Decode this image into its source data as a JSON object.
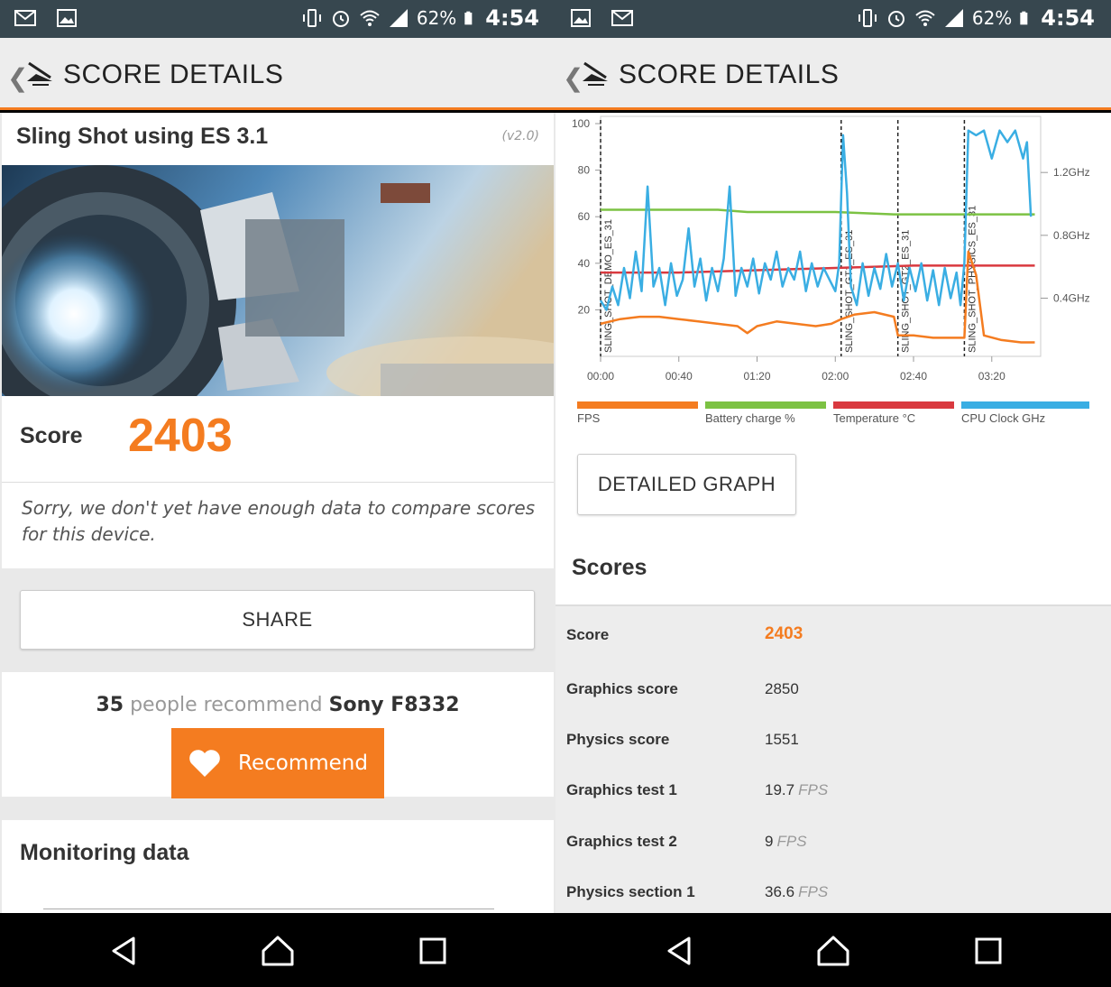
{
  "status": {
    "battery": "62%",
    "time": "4:54"
  },
  "appbar": {
    "title": "SCORE DETAILS"
  },
  "left": {
    "test_title": "Sling Shot using ES 3.1",
    "version": "(v2.0)",
    "score_label": "Score",
    "score_value": "2403",
    "compare_text": "Sorry, we don't yet have enough data to compare scores for this device.",
    "share_label": "SHARE",
    "recommend_count": "35",
    "recommend_text": "people recommend",
    "device": "Sony F8332",
    "recommend_button": "Recommend",
    "monitoring_title": "Monitoring data"
  },
  "right": {
    "detailed_graph_label": "DETAILED GRAPH",
    "scores_title": "Scores",
    "rows": [
      {
        "label": "Score",
        "value": "2403",
        "unit": ""
      },
      {
        "label": "Graphics score",
        "value": "2850",
        "unit": ""
      },
      {
        "label": "Physics score",
        "value": "1551",
        "unit": ""
      },
      {
        "label": "Graphics test 1",
        "value": "19.7",
        "unit": "FPS"
      },
      {
        "label": "Graphics test 2",
        "value": "9",
        "unit": "FPS"
      },
      {
        "label": "Physics section 1",
        "value": "36.6",
        "unit": "FPS"
      }
    ]
  },
  "colors": {
    "accent": "#f47c20",
    "fps": "#f47c20",
    "battery": "#7cc243",
    "temperature": "#d9393f",
    "cpu": "#3aaee3"
  },
  "chart_data": {
    "type": "line",
    "x_ticks": [
      "00:00",
      "00:40",
      "01:20",
      "02:00",
      "02:40",
      "03:20"
    ],
    "y_ticks_left": [
      "20",
      "40",
      "60",
      "80",
      "100"
    ],
    "y_ticks_right": [
      "0.4GHz",
      "0.8GHz",
      "1.2GHz"
    ],
    "ylim": [
      0,
      100
    ],
    "xlim_sec": [
      0,
      225
    ],
    "markers": [
      {
        "t": 0,
        "label": "SLING_SHOT_DEMO_ES_31"
      },
      {
        "t": 123,
        "label": "SLING_SHOT_GT1_ES_31"
      },
      {
        "t": 152,
        "label": "SLING_SHOT_GT2_ES_31"
      },
      {
        "t": 186,
        "label": "SLING_SHOT_PHYSICS_ES_31"
      }
    ],
    "series": [
      {
        "name": "FPS",
        "points": [
          [
            0,
            14
          ],
          [
            10,
            16
          ],
          [
            20,
            17
          ],
          [
            30,
            17
          ],
          [
            40,
            16
          ],
          [
            50,
            15
          ],
          [
            60,
            14
          ],
          [
            70,
            13
          ],
          [
            75,
            10
          ],
          [
            80,
            13
          ],
          [
            90,
            15
          ],
          [
            100,
            14
          ],
          [
            110,
            13
          ],
          [
            118,
            14
          ],
          [
            123,
            16
          ],
          [
            130,
            18
          ],
          [
            140,
            19
          ],
          [
            150,
            17
          ],
          [
            152,
            9
          ],
          [
            160,
            9
          ],
          [
            170,
            8
          ],
          [
            180,
            8
          ],
          [
            186,
            8
          ],
          [
            188,
            45
          ],
          [
            192,
            35
          ],
          [
            196,
            9
          ],
          [
            205,
            7
          ],
          [
            215,
            6
          ],
          [
            222,
            6
          ]
        ]
      },
      {
        "name": "Battery charge %",
        "points": [
          [
            0,
            63
          ],
          [
            60,
            63
          ],
          [
            75,
            62
          ],
          [
            120,
            62
          ],
          [
            150,
            61
          ],
          [
            180,
            61
          ],
          [
            222,
            61
          ]
        ]
      },
      {
        "name": "Temperature °C",
        "points": [
          [
            0,
            36
          ],
          [
            40,
            36
          ],
          [
            80,
            37
          ],
          [
            120,
            38
          ],
          [
            160,
            39
          ],
          [
            200,
            39
          ],
          [
            222,
            39
          ]
        ]
      },
      {
        "name": "CPU Clock GHz",
        "points": [
          [
            0,
            24
          ],
          [
            3,
            20
          ],
          [
            6,
            30
          ],
          [
            9,
            22
          ],
          [
            12,
            38
          ],
          [
            15,
            25
          ],
          [
            18,
            45
          ],
          [
            21,
            28
          ],
          [
            24,
            73
          ],
          [
            27,
            30
          ],
          [
            30,
            38
          ],
          [
            33,
            22
          ],
          [
            36,
            40
          ],
          [
            39,
            26
          ],
          [
            42,
            33
          ],
          [
            45,
            55
          ],
          [
            48,
            30
          ],
          [
            51,
            42
          ],
          [
            54,
            24
          ],
          [
            57,
            38
          ],
          [
            60,
            28
          ],
          [
            63,
            42
          ],
          [
            66,
            73
          ],
          [
            69,
            26
          ],
          [
            72,
            38
          ],
          [
            75,
            30
          ],
          [
            78,
            42
          ],
          [
            81,
            27
          ],
          [
            84,
            40
          ],
          [
            87,
            33
          ],
          [
            90,
            45
          ],
          [
            93,
            30
          ],
          [
            96,
            38
          ],
          [
            99,
            33
          ],
          [
            102,
            45
          ],
          [
            105,
            28
          ],
          [
            108,
            40
          ],
          [
            111,
            30
          ],
          [
            114,
            38
          ],
          [
            117,
            33
          ],
          [
            120,
            28
          ],
          [
            122,
            40
          ],
          [
            124,
            95
          ],
          [
            126,
            70
          ],
          [
            128,
            30
          ],
          [
            131,
            22
          ],
          [
            134,
            40
          ],
          [
            137,
            26
          ],
          [
            140,
            38
          ],
          [
            143,
            29
          ],
          [
            146,
            44
          ],
          [
            149,
            30
          ],
          [
            152,
            40
          ],
          [
            155,
            24
          ],
          [
            158,
            38
          ],
          [
            161,
            28
          ],
          [
            164,
            40
          ],
          [
            167,
            24
          ],
          [
            170,
            37
          ],
          [
            173,
            22
          ],
          [
            176,
            38
          ],
          [
            179,
            25
          ],
          [
            182,
            36
          ],
          [
            184,
            22
          ],
          [
            186,
            40
          ],
          [
            188,
            97
          ],
          [
            192,
            95
          ],
          [
            196,
            97
          ],
          [
            200,
            85
          ],
          [
            204,
            97
          ],
          [
            208,
            92
          ],
          [
            212,
            97
          ],
          [
            216,
            85
          ],
          [
            218,
            92
          ],
          [
            220,
            60
          ]
        ]
      }
    ]
  }
}
